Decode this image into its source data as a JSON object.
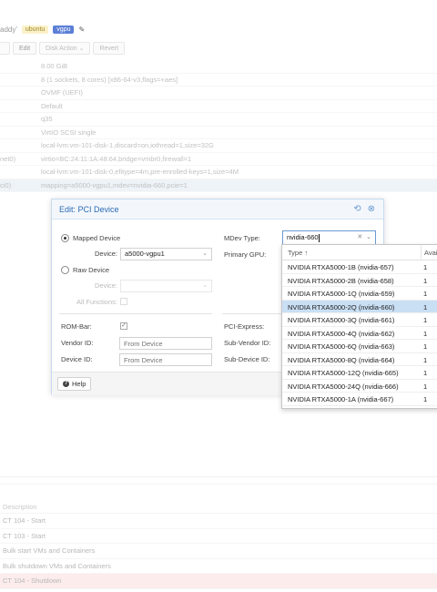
{
  "header": {
    "vm_name": "addy'",
    "tags": [
      "ubuntu",
      "vgpu"
    ]
  },
  "toolbar": {
    "edit": "Edit",
    "disk_action": "Disk Action",
    "revert": "Revert"
  },
  "hardware": [
    {
      "key": "",
      "value": "8.00 GiB"
    },
    {
      "key": "",
      "value": "8 (1 sockets, 8 cores) [x86-64-v3,flags=+aes]"
    },
    {
      "key": "",
      "value": "OVMF (UEFI)"
    },
    {
      "key": "",
      "value": "Default"
    },
    {
      "key": "",
      "value": "q35"
    },
    {
      "key": "",
      "value": "VirtIO SCSI single"
    },
    {
      "key": "",
      "value": "local-lvm:vm-101-disk-1,discard=on,iothread=1,size=32G"
    },
    {
      "key": "net0)",
      "value": "virtio=BC:24:11:1A:48:64,bridge=vmbr0,firewall=1"
    },
    {
      "key": "",
      "value": "local-lvm:vm-101-disk-0,efitype=4m,pre-enrolled-keys=1,size=4M"
    },
    {
      "key": "ci0)",
      "value": "mapping=a5000-vgpu1,mdev=nvidia-660,pcie=1"
    }
  ],
  "dialog": {
    "title": "Edit: PCI Device",
    "mapped_device": "Mapped Device",
    "device_label": "Device:",
    "device_value": "a5000-vgpu1",
    "raw_device": "Raw Device",
    "raw_device_label": "Device:",
    "all_functions": "All Functions:",
    "mdev_type_label": "MDev Type:",
    "mdev_type_value": "nvidia-660",
    "primary_gpu": "Primary GPU:",
    "rom_bar": "ROM-Bar:",
    "pci_express": "PCI-Express:",
    "vendor_id": "Vendor ID:",
    "vendor_placeholder": "From Device",
    "sub_vendor_id": "Sub-Vendor ID:",
    "device_id": "Device ID:",
    "device_placeholder": "From Device",
    "sub_device_id": "Sub-Device ID:",
    "help": "Help"
  },
  "mdev_dropdown": {
    "col_type": "Type ↑",
    "col_avail": "Avail",
    "rows": [
      {
        "type": "NVIDIA RTXA5000-1B (nvidia-657)",
        "avail": "1"
      },
      {
        "type": "NVIDIA RTXA5000-2B (nvidia-658)",
        "avail": "1"
      },
      {
        "type": "NVIDIA RTXA5000-1Q (nvidia-659)",
        "avail": "1"
      },
      {
        "type": "NVIDIA RTXA5000-2Q (nvidia-660)",
        "avail": "1"
      },
      {
        "type": "NVIDIA RTXA5000-3Q (nvidia-661)",
        "avail": "1"
      },
      {
        "type": "NVIDIA RTXA5000-4Q (nvidia-662)",
        "avail": "1"
      },
      {
        "type": "NVIDIA RTXA5000-6Q (nvidia-663)",
        "avail": "1"
      },
      {
        "type": "NVIDIA RTXA5000-8Q (nvidia-664)",
        "avail": "1"
      },
      {
        "type": "NVIDIA RTXA5000-12Q (nvidia-665)",
        "avail": "1"
      },
      {
        "type": "NVIDIA RTXA5000-24Q (nvidia-666)",
        "avail": "1"
      },
      {
        "type": "NVIDIA RTXA5000-1A (nvidia-667)",
        "avail": "1"
      }
    ],
    "selected_index": 3
  },
  "tasks": {
    "header": "Description",
    "rows": [
      "CT 104 - Start",
      "CT 103 - Start",
      "Bulk start VMs and Containers",
      "Bulk shutdown VMs and Containers",
      "CT 104 - Shutdown"
    ]
  }
}
